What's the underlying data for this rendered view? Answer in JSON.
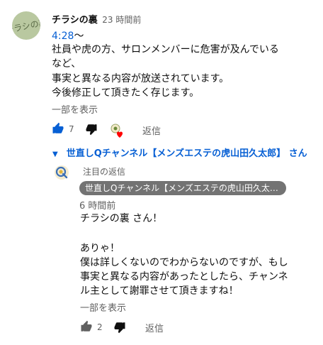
{
  "comment": {
    "author": "チラシの裏",
    "time": "23 時間前",
    "timestamp_link": "4:28",
    "timestamp_suffix": "〜",
    "lines": [
      "社員や虎の方、サロンメンバーに危害が及んでいる",
      "など、",
      "事実と異なる内容が放送されています。",
      "今後修正して頂きたく存じます。"
    ],
    "show_more": "一部を表示",
    "like_count": "7",
    "reply_label": "返信"
  },
  "thread": {
    "label": "世直しQチャンネル【メンズエステの虎山田久太郎】 さん"
  },
  "reply": {
    "pinned_label": "注目の返信",
    "author_chip": "世直しQチャンネル【メンズエステの虎山田久太郎】",
    "time": "6 時間前",
    "lines": [
      "チラシの裏 さん！",
      "",
      "ありゃ！",
      "僕は詳しくないのでわからないのですが、もし",
      "事実と異なる内容があったとしたら、チャンネ",
      "ル主として謝罪させて頂きますね！"
    ],
    "show_more": "一部を表示",
    "like_count": "2",
    "reply_label": "返信"
  },
  "colors": {
    "link": "#065fd4",
    "like_active": "#065fd4",
    "heart": "#ff0000",
    "chip_bg": "#737373"
  },
  "icons": [
    "thumbs-up-icon",
    "thumbs-down-icon",
    "creator-heart-icon",
    "chevron-down-icon",
    "channel-avatar-icon"
  ]
}
